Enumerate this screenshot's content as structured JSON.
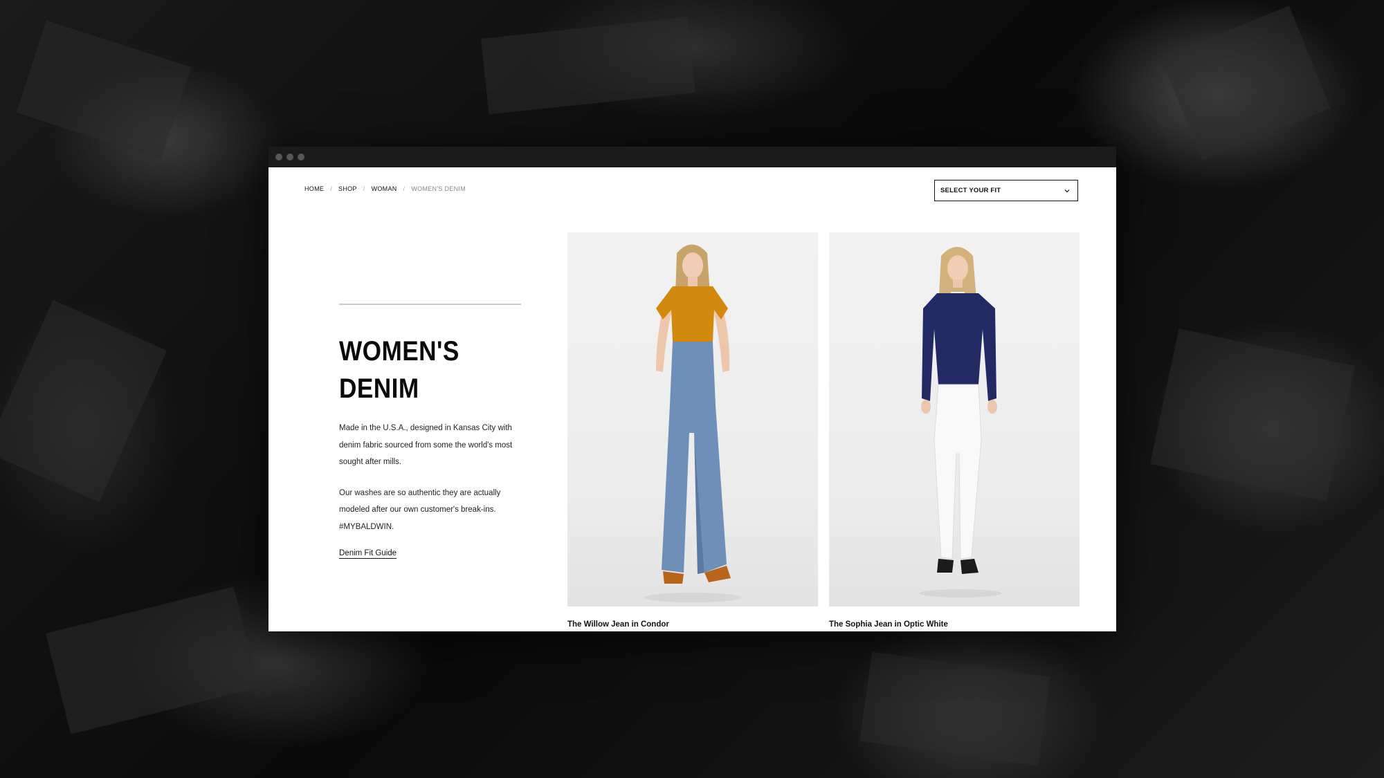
{
  "breadcrumb": {
    "items": [
      "HOME",
      "SHOP",
      "WOMAN"
    ],
    "current": "WOMEN'S DENIM",
    "separator": "/"
  },
  "fit_select": {
    "value": "SELECT YOUR FIT",
    "icon": "chevron-down-icon"
  },
  "intro": {
    "heading_line1": "WOMEN'S",
    "heading_line2": "DENIM",
    "paragraph1": "Made in the U.S.A., designed in Kansas City with denim fabric sourced from some the world's most sought after mills.",
    "paragraph2_line1": "Our washes are so authentic they are actually modeled after our own customer's break-ins.",
    "paragraph2_line2": "#MYBALDWIN.",
    "link": "Denim Fit Guide"
  },
  "products": [
    {
      "name": "The Willow Jean in Condor",
      "top_color": "#d18a0e",
      "jean_color": "#6d8fb8"
    },
    {
      "name": "The Sophia Jean in Optic White",
      "top_color": "#232a63",
      "jean_color": "#f7f7f7"
    }
  ],
  "colors": {
    "window_bar": "#1b1b1b",
    "text": "#111111",
    "muted": "#888888"
  }
}
